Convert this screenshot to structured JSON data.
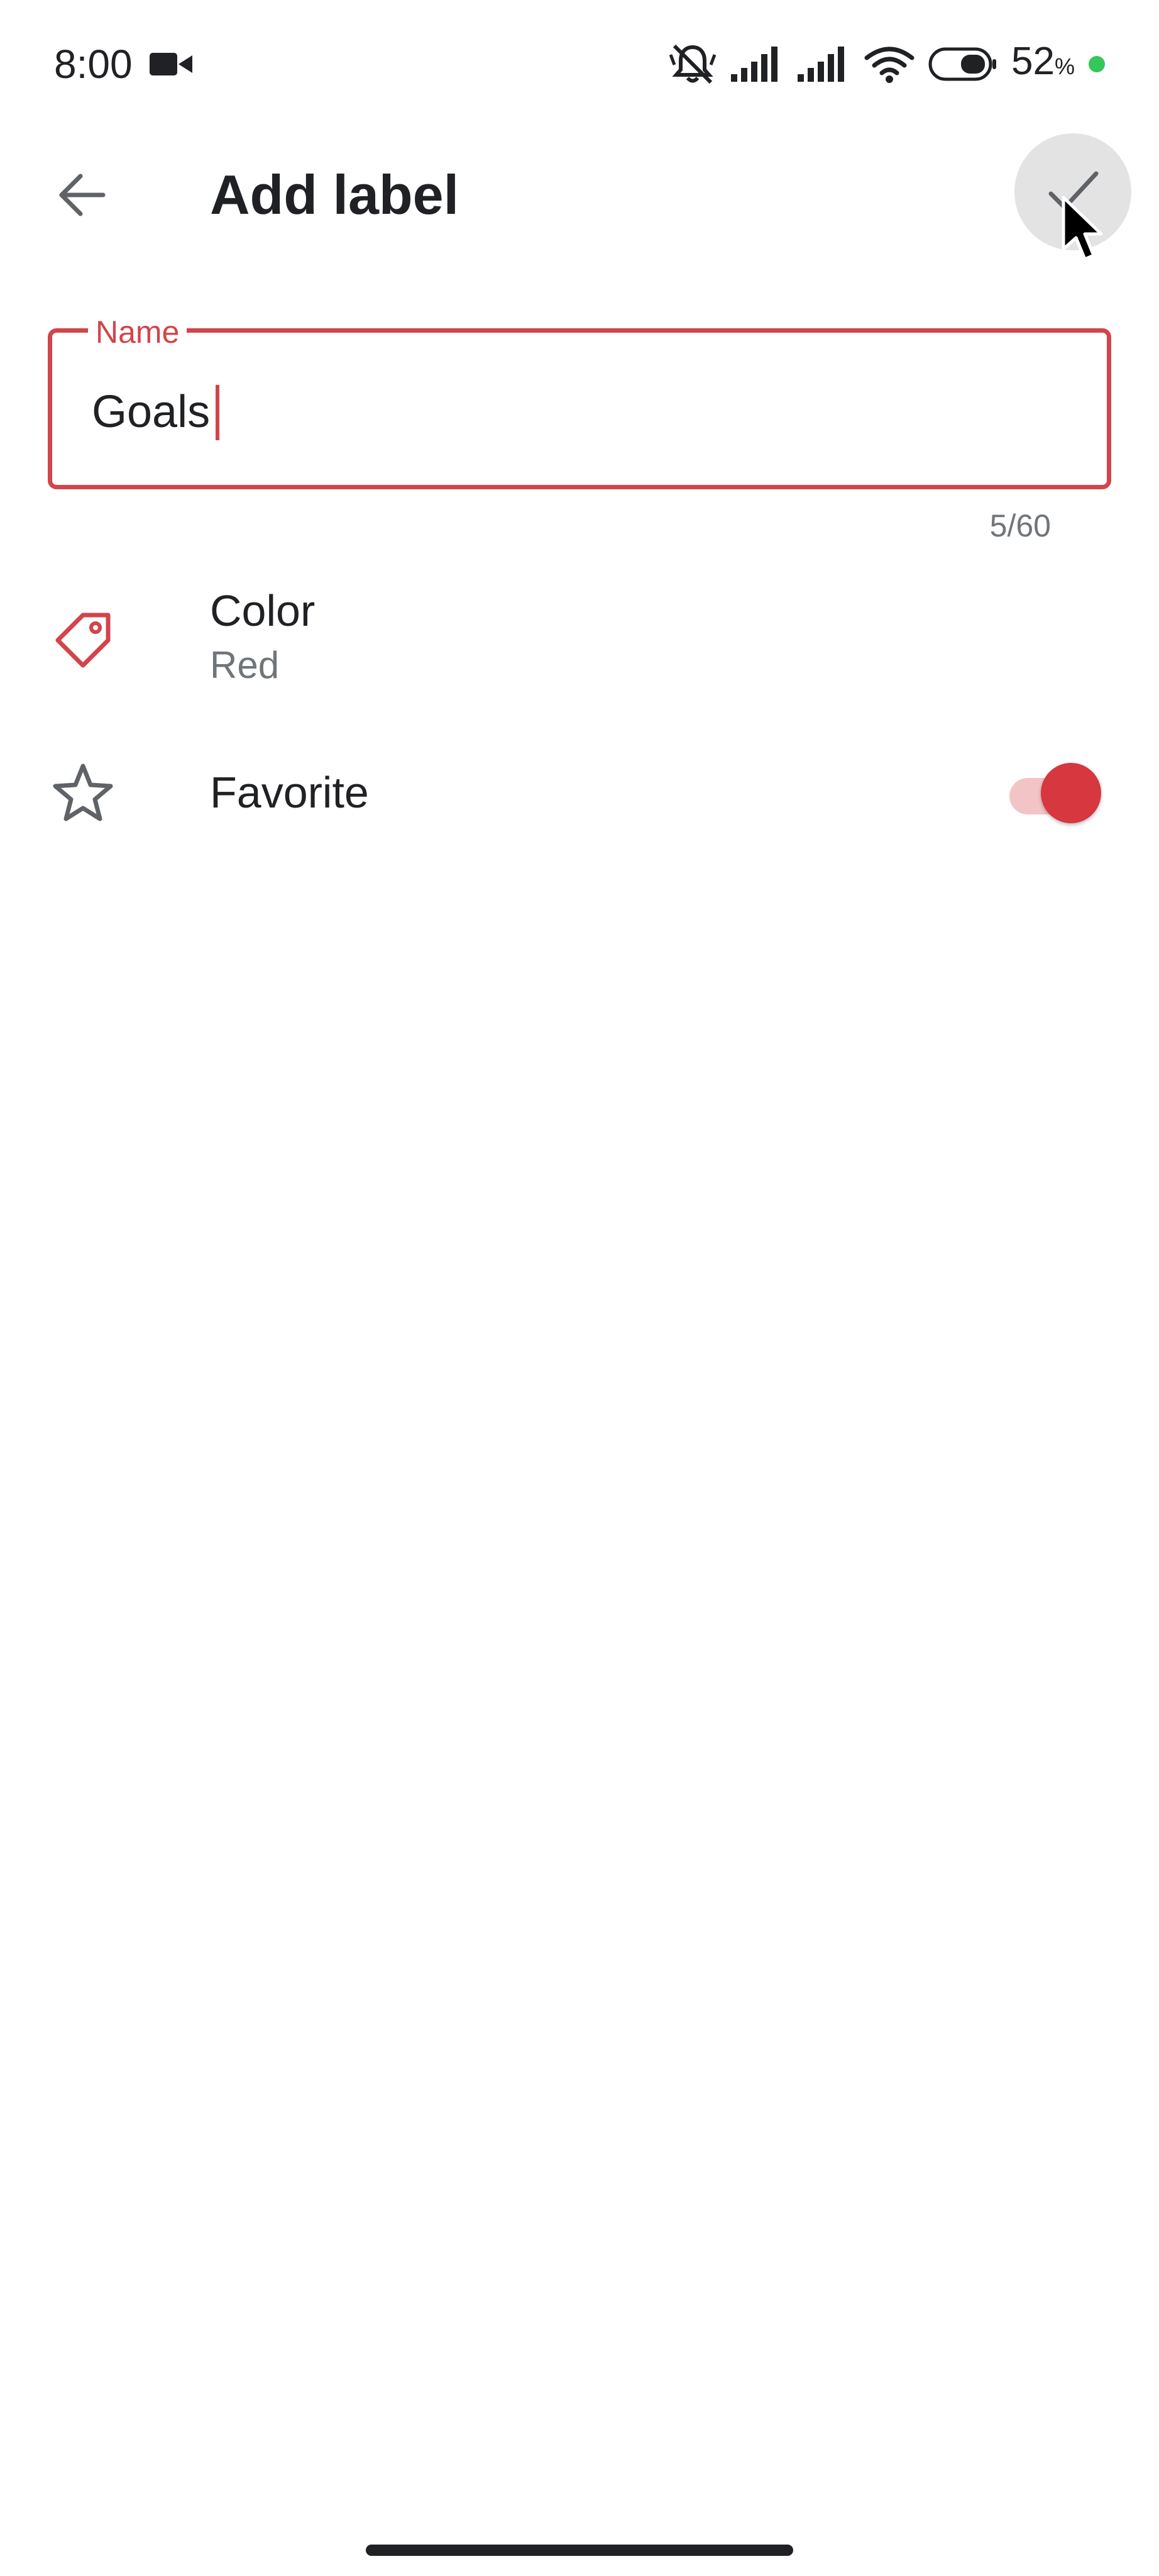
{
  "status_bar": {
    "time": "8:00",
    "battery_level": "52",
    "battery_unit": "%",
    "icons": [
      "video-camera-icon",
      "bell-muted-icon",
      "signal-icon",
      "signal-icon",
      "wifi-icon",
      "battery-icon",
      "charging-dot"
    ]
  },
  "app_bar": {
    "title": "Add label",
    "back_icon": "arrow-left-icon",
    "confirm_icon": "check-icon"
  },
  "name_field": {
    "label": "Name",
    "value": "Goals",
    "counter": "5/60"
  },
  "color_row": {
    "title": "Color",
    "value": "Red",
    "icon": "label-tag-icon"
  },
  "favorite_row": {
    "title": "Favorite",
    "icon": "star-icon",
    "enabled": true
  },
  "colors": {
    "accent": "#d1454b",
    "toggle_thumb": "#d7373f",
    "toggle_track": "#f3c4c6",
    "text_primary": "#202124",
    "text_secondary": "#70757a",
    "charging": "#34c759"
  }
}
